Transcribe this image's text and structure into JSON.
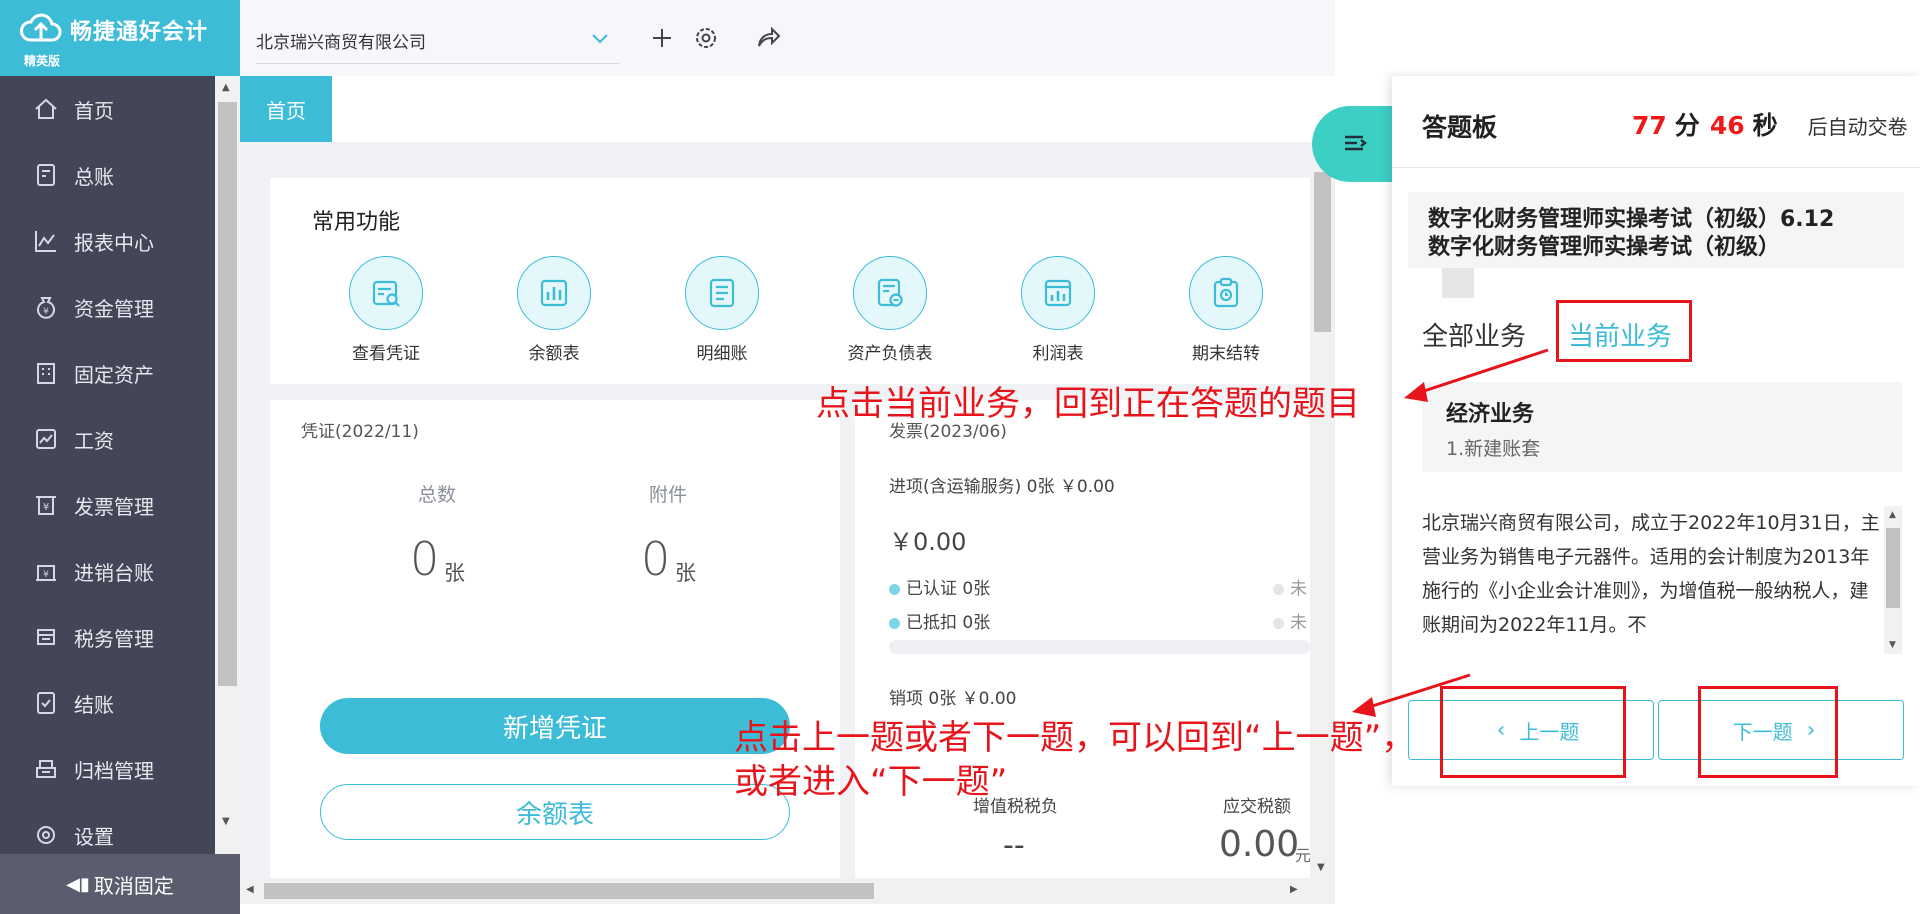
{
  "app": {
    "name": "畅捷通好会计",
    "edition": "精英版"
  },
  "sidebar": {
    "items": [
      {
        "label": "首页",
        "icon": "home-icon"
      },
      {
        "label": "总账",
        "icon": "ledger-icon"
      },
      {
        "label": "报表中心",
        "icon": "chart-icon"
      },
      {
        "label": "资金管理",
        "icon": "money-bag-icon"
      },
      {
        "label": "固定资产",
        "icon": "building-icon"
      },
      {
        "label": "工资",
        "icon": "salary-icon"
      },
      {
        "label": "发票管理",
        "icon": "invoice-icon"
      },
      {
        "label": "进销台账",
        "icon": "inventory-icon"
      },
      {
        "label": "税务管理",
        "icon": "tax-icon"
      },
      {
        "label": "结账",
        "icon": "close-book-icon"
      },
      {
        "label": "归档管理",
        "icon": "archive-icon"
      },
      {
        "label": "设置",
        "icon": "settings-icon"
      }
    ],
    "unpin_label": "取消固定"
  },
  "header": {
    "company": "北京瑞兴商贸有限公司"
  },
  "tabs": {
    "home": "首页"
  },
  "quick": {
    "title": "常用功能",
    "items": [
      {
        "label": "查看凭证",
        "icon": "voucher-search-icon"
      },
      {
        "label": "余额表",
        "icon": "bar-chart-icon"
      },
      {
        "label": "明细账",
        "icon": "detail-list-icon"
      },
      {
        "label": "资产负债表",
        "icon": "balance-sheet-icon"
      },
      {
        "label": "利润表",
        "icon": "profit-chart-icon"
      },
      {
        "label": "期末结转",
        "icon": "clipboard-icon"
      }
    ]
  },
  "voucher": {
    "title": "凭证(2022/11)",
    "total_label": "总数",
    "total_value": "0",
    "total_unit": "张",
    "attach_label": "附件",
    "attach_value": "0",
    "attach_unit": "张",
    "new_btn": "新增凭证",
    "balance_btn": "余额表"
  },
  "invoice": {
    "title": "发票(2023/06)",
    "input_line": "进项(含运输服务)  0张  ￥0.00",
    "input_amount": "￥0.00",
    "certified": "已认证   0张",
    "deducted": "已抵扣   0张",
    "uncert": "未",
    "undeduct": "未",
    "output_line": "销项    0张     ￥0.00",
    "vat_label": "增值税税负",
    "vat_value": "--",
    "tax_label": "应交税额",
    "tax_value": "0.00",
    "tax_unit": "元"
  },
  "panel": {
    "title": "答题板",
    "minutes": "77",
    "min_unit": "分",
    "seconds": "46",
    "sec_unit": "秒",
    "suffix": "后自动交卷",
    "exam_line1": "数字化财务管理师实操考试（初级）6.12",
    "exam_line2": "数字化财务管理师实操考试（初级）",
    "tab_all": "全部业务",
    "tab_current": "当前业务",
    "biz_title": "经济业务",
    "biz_item": "1.新建账套",
    "description": "北京瑞兴商贸有限公司，成立于2022年10月31日，主营业务为销售电子元器件。适用的会计制度为2013年施行的《小企业会计准则》，为增值税一般纳税人，建账期间为2022年11月。不",
    "prev": "上一题",
    "next": "下一题"
  },
  "annotations": {
    "a1": "点击当前业务，回到正在答题的题目",
    "a2_line1": "点击上一题或者下一题，可以回到“上一题”，",
    "a2_line2": "或者进入“下一题”",
    "color": "#e8141c"
  },
  "colors": {
    "brand": "#3dbcd8",
    "sidebar": "#434656",
    "timer": "#f01818",
    "toggle": "#3ecfc4"
  }
}
